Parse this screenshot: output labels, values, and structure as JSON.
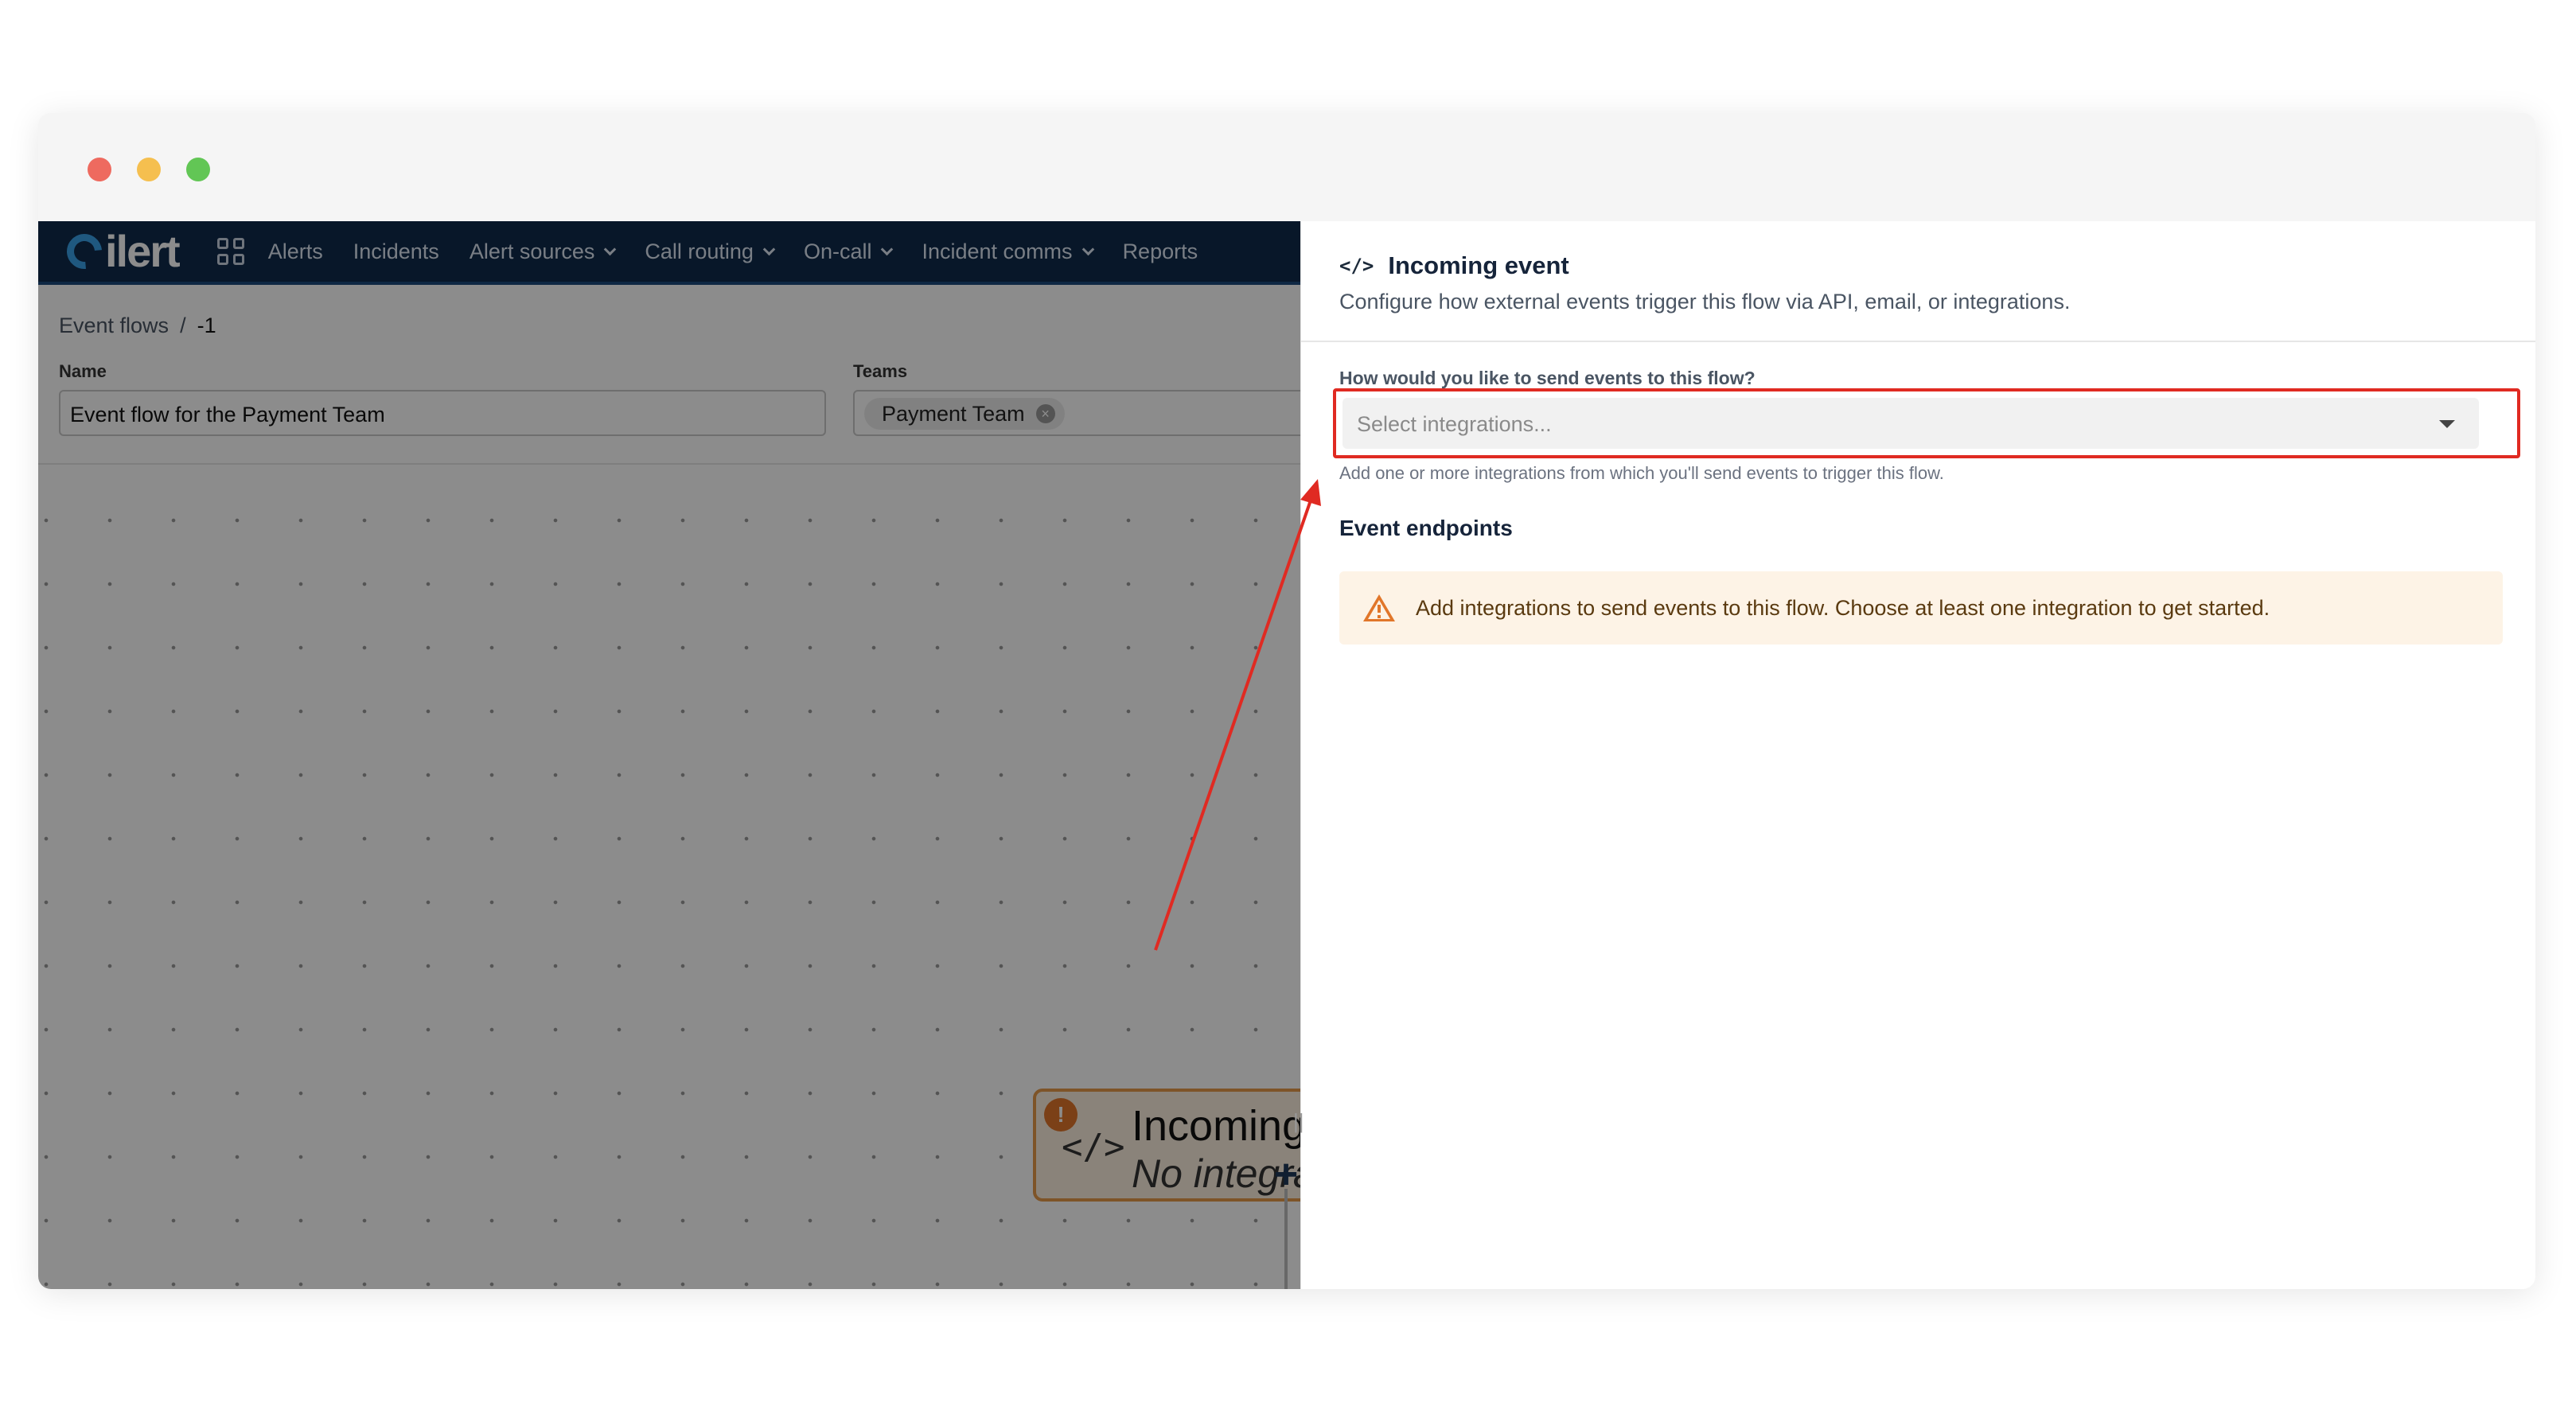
{
  "nav": {
    "logo": "ilert",
    "items": [
      {
        "label": "Alerts",
        "dropdown": false
      },
      {
        "label": "Incidents",
        "dropdown": false
      },
      {
        "label": "Alert sources",
        "dropdown": true
      },
      {
        "label": "Call routing",
        "dropdown": true
      },
      {
        "label": "On-call",
        "dropdown": true
      },
      {
        "label": "Incident comms",
        "dropdown": true
      },
      {
        "label": "Reports",
        "dropdown": false
      }
    ]
  },
  "breadcrumb": {
    "parent": "Event flows",
    "separator": "/",
    "current": "-1"
  },
  "form": {
    "name_label": "Name",
    "name_value": "Event flow for the Payment Team",
    "teams_label": "Teams",
    "team_chip": "Payment Team"
  },
  "node": {
    "title": "Incoming event",
    "subtitle": "No integrations",
    "code_glyph": "</>",
    "warning_glyph": "!"
  },
  "panel": {
    "code_glyph": "</>",
    "title": "Incoming event",
    "description": "Configure how external events trigger this flow via API, email, or integrations.",
    "question": "How would you like to send events to this flow?",
    "select_placeholder": "Select integrations...",
    "help": "Add one or more integrations from which you'll send events to trigger this flow.",
    "endpoints_title": "Event endpoints",
    "alert_text": "Add integrations to send events to this flow. Choose at least one integration to get started."
  },
  "colors": {
    "nav_bg": "#0f2b4c",
    "highlight": "#e02a22",
    "warning": "#e1762a",
    "alert_bg": "#fdf3e6"
  }
}
